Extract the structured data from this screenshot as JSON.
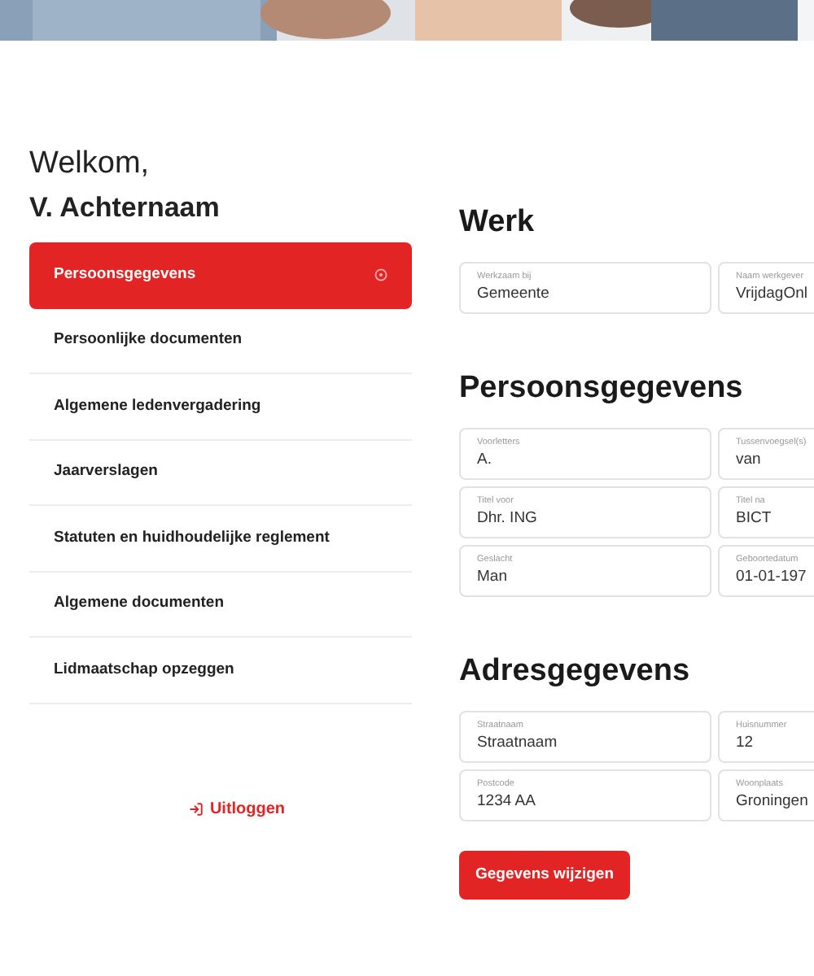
{
  "welcome": {
    "greeting": "Welkom,",
    "name": "V. Achternaam"
  },
  "sidebar": {
    "items": [
      {
        "label": "Persoonsgegevens",
        "selected": true
      },
      {
        "label": "Persoonlijke documenten",
        "selected": false
      },
      {
        "label": "Algemene ledenvergadering",
        "selected": false
      },
      {
        "label": "Jaarverslagen",
        "selected": false
      },
      {
        "label": "Statuten en huidhoudelijke reglement",
        "selected": false
      },
      {
        "label": "Algemene documenten",
        "selected": false
      },
      {
        "label": "Lidmaatschap opzeggen",
        "selected": false
      }
    ],
    "logout": "Uitloggen"
  },
  "sections": [
    {
      "title": "Werk",
      "fields": [
        {
          "label": "Werkzaam bij",
          "value": "Gemeente"
        },
        {
          "label": "Naam werkgever",
          "value": "VrijdagOnl"
        }
      ]
    },
    {
      "title": "Persoonsgegevens",
      "fields": [
        {
          "label": "Voorletters",
          "value": "A."
        },
        {
          "label": "Tussenvoegsel(s)",
          "value": "van"
        },
        {
          "label": "Titel voor",
          "value": "Dhr. ING"
        },
        {
          "label": "Titel na",
          "value": "BICT"
        },
        {
          "label": "Geslacht",
          "value": "Man"
        },
        {
          "label": "Geboortedatum",
          "value": "01-01-197"
        }
      ]
    },
    {
      "title": "Adresgegevens",
      "fields": [
        {
          "label": "Straatnaam",
          "value": "Straatnaam"
        },
        {
          "label": "Huisnummer",
          "value": "12"
        },
        {
          "label": "Postcode",
          "value": "1234 AA"
        },
        {
          "label": "Woonplaats",
          "value": "Groningen"
        }
      ]
    }
  ],
  "submit": "Gegevens wijzigen"
}
